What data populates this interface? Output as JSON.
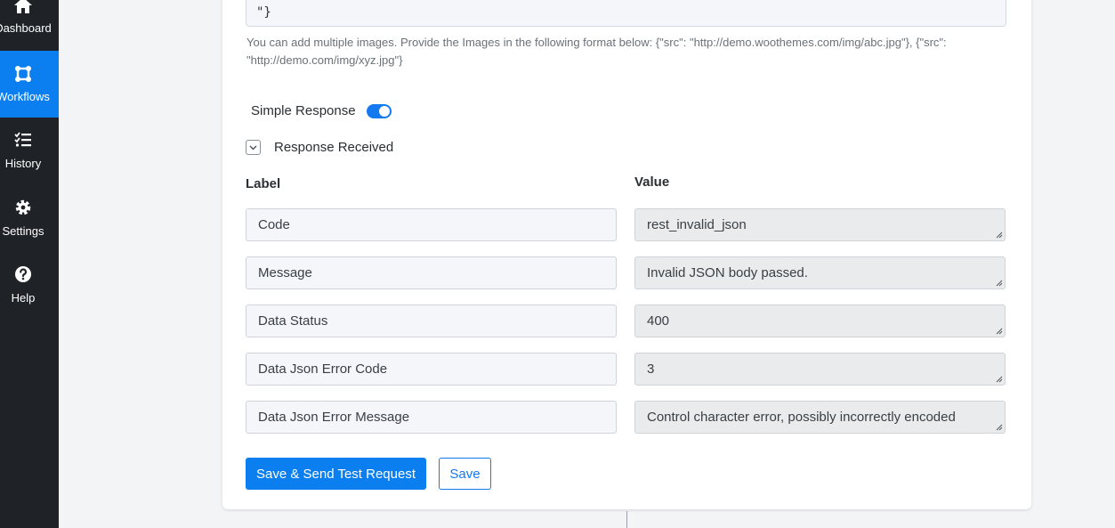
{
  "sidebar": {
    "items": [
      {
        "label": "Dashboard",
        "icon": "home-icon",
        "active": false
      },
      {
        "label": "Workflows",
        "icon": "workflow-icon",
        "active": true
      },
      {
        "label": "History",
        "icon": "history-list-icon",
        "active": false
      },
      {
        "label": "Settings",
        "icon": "gear-icon",
        "active": false
      },
      {
        "label": "Help",
        "icon": "help-icon",
        "active": false
      }
    ]
  },
  "form": {
    "images_value": "\"}",
    "images_helper": "You can add multiple images. Provide the Images in the following format below: {\"src\": \"http://demo.woothemes.com/img/abc.jpg\"}, {\"src\": \"http://demo.com/img/xyz.jpg\"}",
    "simple_response_label": "Simple Response",
    "simple_response_on": true,
    "response_received_label": "Response Received",
    "label_header": "Label",
    "value_header": "Value",
    "rows": [
      {
        "label": "Code",
        "value": "rest_invalid_json"
      },
      {
        "label": "Message",
        "value": "Invalid JSON body passed."
      },
      {
        "label": "Data Status",
        "value": "400"
      },
      {
        "label": "Data Json Error Code",
        "value": "3"
      },
      {
        "label": "Data Json Error Message",
        "value": "Control character error, possibly incorrectly encoded"
      }
    ],
    "save_send_label": "Save & Send Test Request",
    "save_label": "Save"
  },
  "colors": {
    "sidebar_bg": "#1f2328",
    "accent": "#0b7ff0"
  }
}
